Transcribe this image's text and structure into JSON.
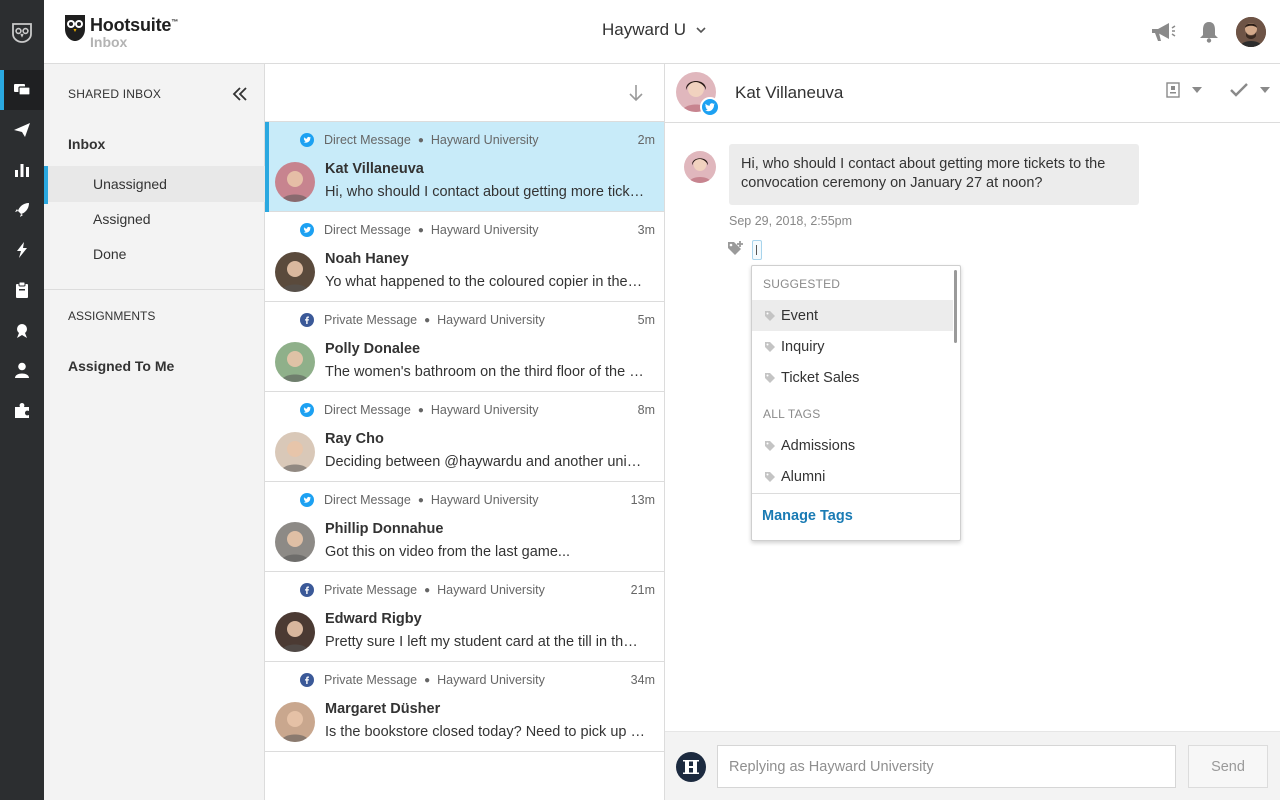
{
  "app": {
    "brand": "Hootsuite",
    "brand_tm": "™",
    "section": "Inbox",
    "org_selector": "Hayward U"
  },
  "rail": {
    "items": [
      {
        "icon": "streams-icon"
      },
      {
        "icon": "inbox-icon",
        "active": true
      },
      {
        "icon": "publisher-icon"
      },
      {
        "icon": "analytics-icon"
      },
      {
        "icon": "boost-icon"
      },
      {
        "icon": "amplify-icon"
      },
      {
        "icon": "assignments-icon"
      },
      {
        "icon": "campaigns-icon"
      },
      {
        "icon": "contacts-icon"
      },
      {
        "icon": "apps-icon"
      }
    ]
  },
  "nav": {
    "header": "SHARED INBOX",
    "inbox_label": "Inbox",
    "sub_items": [
      "Unassigned",
      "Assigned",
      "Done"
    ],
    "assignments_header": "ASSIGNMENTS",
    "assigned_to_me": "Assigned To Me"
  },
  "messages": [
    {
      "network": "twitter",
      "type": "Direct Message",
      "account": "Hayward University",
      "time": "2m",
      "name": "Kat Villaneuva",
      "preview": "Hi, who should I contact about getting more tickets to the convocation ceremony on January 27 at noon?",
      "avatar_color": "#c7848f",
      "selected": true
    },
    {
      "network": "twitter",
      "type": "Direct Message",
      "account": "Hayward University",
      "time": "3m",
      "name": "Noah Haney",
      "preview": "Yo what happened to the coloured copier in the library?",
      "avatar_color": "#5a4a3c"
    },
    {
      "network": "facebook",
      "type": "Private Message",
      "account": "Hayward University",
      "time": "5m",
      "name": "Polly Donalee",
      "preview": "The women's bathroom on the third floor of the arts building is out of order",
      "avatar_color": "#8fb08a"
    },
    {
      "network": "twitter",
      "type": "Direct Message",
      "account": "Hayward University",
      "time": "8m",
      "name": "Ray Cho",
      "preview": "Deciding between @haywardu and another university, any advice?",
      "avatar_color": "#d9c8b8"
    },
    {
      "network": "twitter",
      "type": "Direct Message",
      "account": "Hayward University",
      "time": "13m",
      "name": "Phillip Donnahue",
      "preview": "Got this on video from the last game...",
      "avatar_color": "#8d8a86"
    },
    {
      "network": "facebook",
      "type": "Private Message",
      "account": "Hayward University",
      "time": "21m",
      "name": "Edward Rigby",
      "preview": "Pretty sure I left my student card at the till in the cafeteria",
      "avatar_color": "#4b3a33"
    },
    {
      "network": "facebook",
      "type": "Private Message",
      "account": "Hayward University",
      "time": "34m",
      "name": "Margaret Düsher",
      "preview": "Is the bookstore closed today? Need to pick up my textbooks",
      "avatar_color": "#c9a78e"
    }
  ],
  "conversation": {
    "contact_name": "Kat Villaneuva",
    "message_line1": "Hi, who should I contact about getting more tickets to the",
    "message_line2": "convocation ceremony on January 27 at noon?",
    "timestamp": "Sep 29, 2018, 2:55pm"
  },
  "tags_dropdown": {
    "suggested_header": "SUGGESTED",
    "suggested": [
      "Event",
      "Inquiry",
      "Ticket Sales"
    ],
    "all_header": "ALL TAGS",
    "all": [
      "Admissions",
      "Alumni"
    ],
    "manage_label": "Manage Tags"
  },
  "reply": {
    "placeholder": "Replying as Hayward University",
    "send_label": "Send"
  },
  "colors": {
    "rail_bg": "#2c2e30",
    "accent": "#2aa8e0",
    "selected_row": "#c8ebf9",
    "twitter": "#1da1f2",
    "facebook": "#3b5998",
    "link": "#1a7bb4"
  }
}
